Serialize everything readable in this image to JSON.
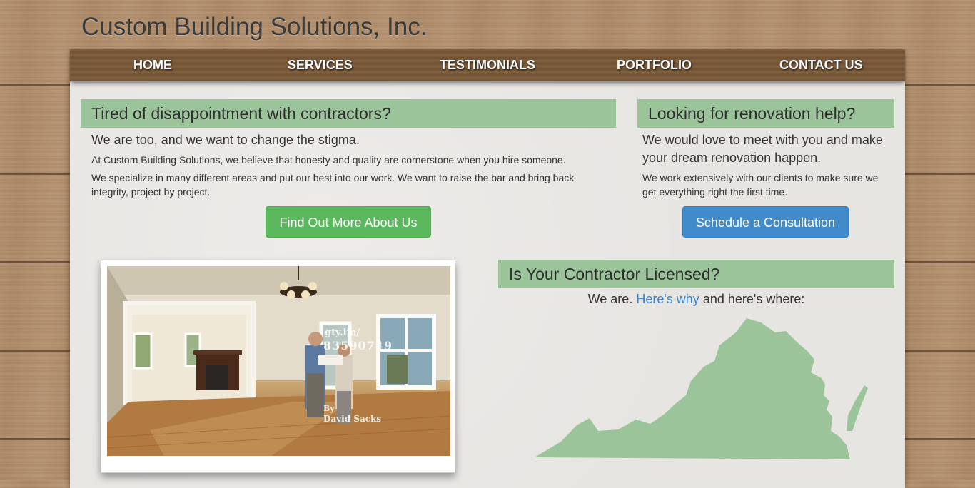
{
  "site": {
    "title": "Custom Building Solutions, Inc."
  },
  "nav": {
    "items": [
      {
        "label": "HOME"
      },
      {
        "label": "SERVICES"
      },
      {
        "label": "TESTIMONIALS"
      },
      {
        "label": "PORTFOLIO"
      },
      {
        "label": "CONTACT US"
      }
    ]
  },
  "left_panel": {
    "heading": "Tired of disappointment with contractors?",
    "lead": "We are too, and we want to change the stigma.",
    "para1": "At Custom Building Solutions, we believe that honesty and quality are cornerstone when you hire someone.",
    "para2": "We specialize in many different areas and put our best into our work. We want to raise the bar and bring back integrity, project by project.",
    "button": "Find Out More About Us",
    "button_color": "#5cb85c"
  },
  "right_panel": {
    "heading": "Looking for renovation help?",
    "lead": "We would love to meet with you and make your dream renovation happen.",
    "para": "We work extensively with our clients to make sure we get everything right the first time.",
    "button": "Schedule a Consultation",
    "button_color": "#428bca"
  },
  "photo": {
    "watermark_id_prefix": "gty.im/",
    "watermark_id": "83590749",
    "watermark_by": "By",
    "watermark_author": "David Sacks"
  },
  "licensed": {
    "heading": "Is Your Contractor Licensed?",
    "text_before": "We are.",
    "link": "Here's why",
    "text_after": "and here's where:",
    "map_color": "#9bc49b"
  },
  "colors": {
    "heading_bg": "#9bc49b",
    "nav_bg": "#7a5937",
    "link": "#3c82c8"
  }
}
